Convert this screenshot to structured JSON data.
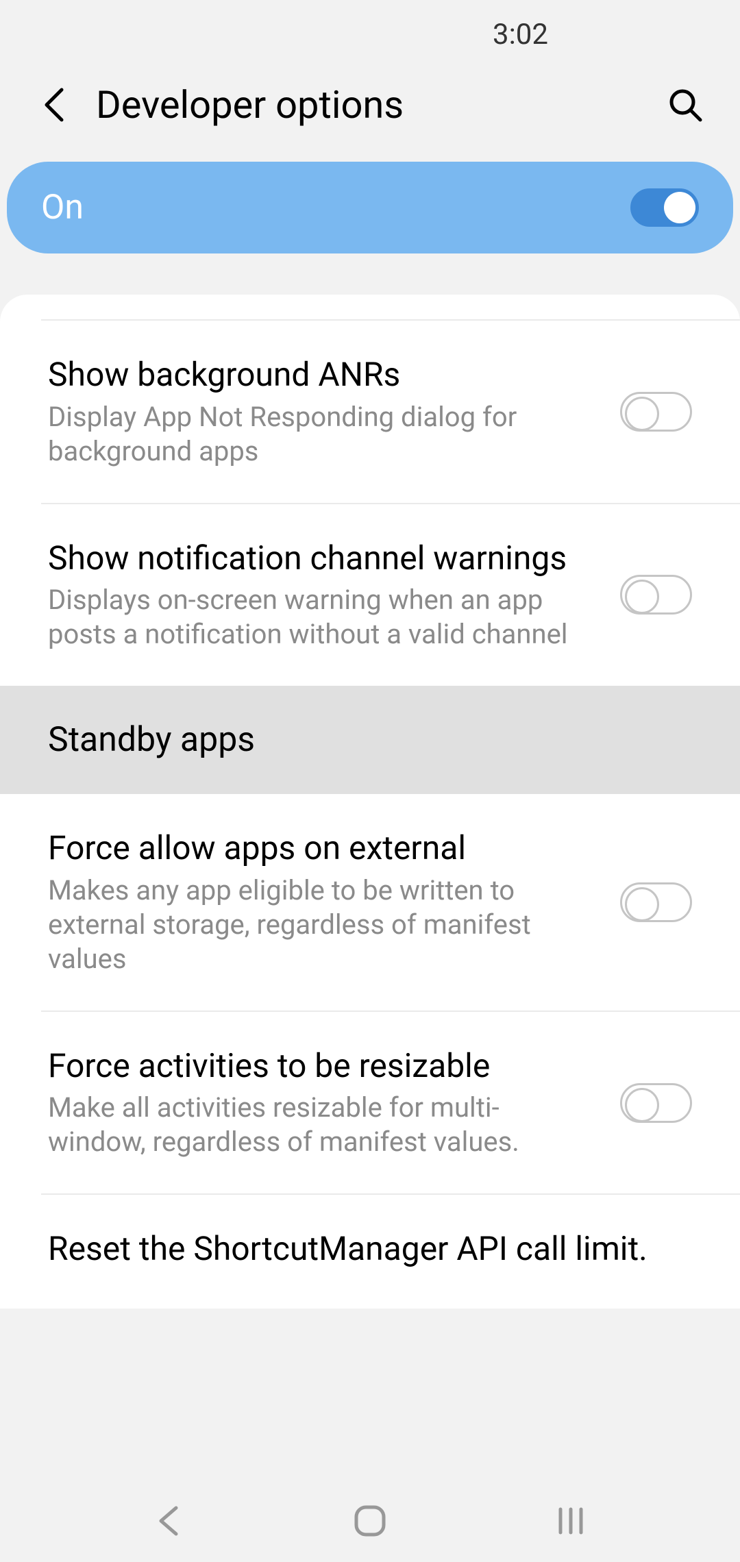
{
  "status": {
    "time": "3:02"
  },
  "header": {
    "title": "Developer options"
  },
  "master": {
    "label": "On",
    "enabled": true
  },
  "settings": [
    {
      "title": "Show background ANRs",
      "desc": "Display App Not Responding dialog for background apps",
      "enabled": false
    },
    {
      "title": "Show notification channel warnings",
      "desc": "Displays on-screen warning when an app posts a notification without a valid channel",
      "enabled": false
    }
  ],
  "standby": {
    "label": "Standby apps"
  },
  "settings2": [
    {
      "title": "Force allow apps on external",
      "desc": "Makes any app eligible to be written to external storage, regardless of manifest values",
      "enabled": false
    },
    {
      "title": "Force activities to be resizable",
      "desc": "Make all activities resizable for multi-window, regardless of manifest values.",
      "enabled": false
    },
    {
      "title": "Reset the ShortcutManager API call limit.",
      "desc": "",
      "enabled": null
    }
  ]
}
